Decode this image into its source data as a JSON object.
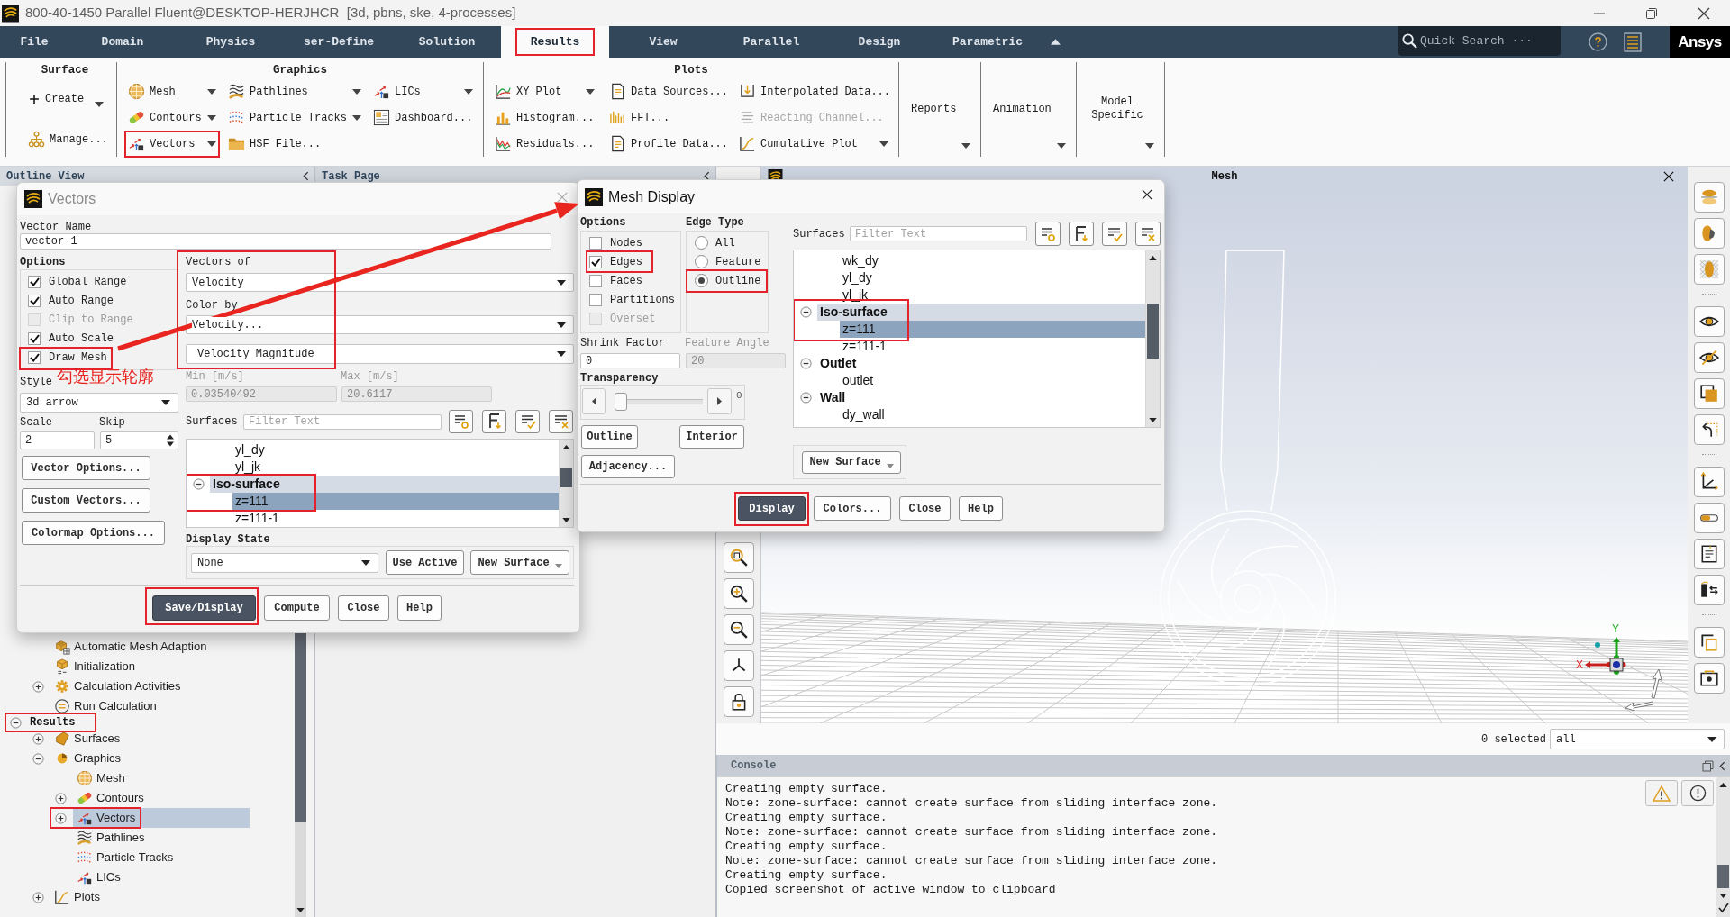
{
  "window": {
    "title": "800-40-1450 Parallel Fluent@DESKTOP-HERJHCR  [3d, pbns, ske, 4-processes]"
  },
  "menu_tabs": [
    {
      "label": "File",
      "selected": false
    },
    {
      "label": "Domain",
      "selected": false
    },
    {
      "label": "Physics",
      "selected": false
    },
    {
      "label": "ser-Define",
      "selected": false
    },
    {
      "label": "Solution",
      "selected": false
    },
    {
      "label": "Results",
      "selected": true,
      "highlighted": true
    },
    {
      "label": "View",
      "selected": false
    },
    {
      "label": "Parallel",
      "selected": false
    },
    {
      "label": "Design",
      "selected": false
    },
    {
      "label": "Parametric",
      "selected": false
    }
  ],
  "quick_search": {
    "placeholder": "Quick Search ···"
  },
  "logo": {
    "text": "Ansys"
  },
  "ribbon": [
    {
      "kind": "stack",
      "title": "Surface",
      "items": [
        {
          "label": "Create",
          "dropdown": true,
          "disabled": false
        },
        {
          "label": "Manage...",
          "disabled": false
        }
      ]
    },
    {
      "kind": "grid",
      "title": "Graphics",
      "columns": [
        [
          {
            "label": "Mesh",
            "dropdown": true,
            "disabled": false
          },
          {
            "label": "Contours",
            "dropdown": true,
            "disabled": false
          },
          {
            "label": "Vectors",
            "dropdown": true,
            "disabled": false,
            "highlighted": true
          }
        ],
        [
          {
            "label": "Pathlines",
            "dropdown": true,
            "disabled": false
          },
          {
            "label": "Particle Tracks",
            "dropdown": true,
            "disabled": false
          },
          {
            "label": "HSF File...",
            "disabled": false
          }
        ],
        [
          {
            "label": "LICs",
            "dropdown": true,
            "disabled": false
          },
          {
            "label": "Dashboard...",
            "disabled": false
          }
        ]
      ]
    },
    {
      "kind": "grid",
      "title": "Plots",
      "columns": [
        [
          {
            "label": "XY Plot",
            "dropdown": true,
            "disabled": false
          },
          {
            "label": "Histogram...",
            "disabled": false
          },
          {
            "label": "Residuals...",
            "disabled": false
          }
        ],
        [
          {
            "label": "Data Sources...",
            "disabled": false
          },
          {
            "label": "FFT...",
            "disabled": false
          },
          {
            "label": "Profile Data...",
            "disabled": false
          }
        ],
        [
          {
            "label": "Interpolated Data...",
            "disabled": false
          },
          {
            "label": "Reacting Channel...",
            "disabled": true
          },
          {
            "label": "Cumulative Plot",
            "dropdown": true,
            "disabled": false
          }
        ]
      ]
    },
    {
      "kind": "menu",
      "label": "Reports"
    },
    {
      "kind": "menu",
      "label": "Animation"
    },
    {
      "kind": "menu",
      "label": "Model Specific"
    }
  ],
  "outline_view": {
    "title": "Outline View",
    "tree": [
      {
        "children": [
          {
            "label": "Automatic Mesh Adaption",
            "selected": false
          },
          {
            "label": "Initialization",
            "selected": false
          },
          {
            "label": "Calculation Activities",
            "expanded": false,
            "selected": false
          },
          {
            "label": "Run Calculation",
            "selected": false
          }
        ]
      },
      {
        "label": "Results",
        "expanded": true,
        "selected": false,
        "highlighted": true,
        "children": [
          {
            "label": "Surfaces",
            "expanded": false,
            "selected": false
          },
          {
            "label": "Graphics",
            "expanded": true,
            "selected": false,
            "children": [
              {
                "label": "Mesh",
                "selected": false
              },
              {
                "label": "Contours",
                "expanded": false,
                "selected": false
              },
              {
                "label": "Vectors",
                "expanded": false,
                "selected": true,
                "highlighted": true
              },
              {
                "label": "Pathlines",
                "selected": false
              },
              {
                "label": "Particle Tracks",
                "selected": false
              },
              {
                "label": "LICs",
                "selected": false
              }
            ]
          },
          {
            "label": "Plots",
            "expanded": false,
            "selected": false
          }
        ]
      }
    ]
  },
  "task_page": {
    "title": "Task Page"
  },
  "graphics_window": {
    "title": "Mesh",
    "triad": {
      "x_label": "X",
      "y_label": "Y"
    },
    "selection": {
      "count": "0 selected",
      "filter": "all"
    }
  },
  "console": {
    "title": "Console",
    "lines": [
      "Creating empty surface.",
      "Note: zone-surface: cannot create surface from sliding interface zone.",
      "Creating empty surface.",
      "Note: zone-surface: cannot create surface from sliding interface zone.",
      "Creating empty surface.",
      "Note: zone-surface: cannot create surface from sliding interface zone.",
      "Creating empty surface.",
      "Copied screenshot of active window to clipboard"
    ]
  },
  "vectors_dialog": {
    "title": "Vectors",
    "active": false,
    "vector_name": {
      "label": "Vector Name",
      "value": "vector-1"
    },
    "options": {
      "label": "Options",
      "items": [
        {
          "label": "Global Range",
          "checked": true,
          "disabled": false
        },
        {
          "label": "Auto Range",
          "checked": true,
          "disabled": false
        },
        {
          "label": "Clip to Range",
          "checked": false,
          "disabled": true
        },
        {
          "label": "Auto Scale",
          "checked": true,
          "disabled": false
        },
        {
          "label": "Draw Mesh",
          "checked": true,
          "disabled": false,
          "highlighted": true
        }
      ]
    },
    "style": {
      "label": "Style",
      "value": "3d arrow"
    },
    "scale": {
      "label": "Scale",
      "value": "2"
    },
    "skip": {
      "label": "Skip",
      "value": "5"
    },
    "side_buttons": [
      {
        "label": "Vector Options..."
      },
      {
        "label": "Custom Vectors..."
      },
      {
        "label": "Colormap Options..."
      }
    ],
    "vectors_of": {
      "label": "Vectors of",
      "value": "Velocity",
      "highlighted": true
    },
    "color_by": {
      "label": "Color by",
      "value": "Velocity...",
      "quantity": "Velocity Magnitude"
    },
    "min": {
      "label": "Min [m/s]",
      "value": "0.03540492",
      "disabled": true
    },
    "max": {
      "label": "Max [m/s]",
      "value": "20.6117",
      "disabled": true
    },
    "surfaces": {
      "label": "Surfaces",
      "placeholder": "Filter Text",
      "items": [
        {
          "children": [
            {
              "label": "yl_dy",
              "selected": false
            },
            {
              "label": "yl_jk",
              "selected": false
            }
          ]
        },
        {
          "label": "Iso-surface",
          "expanded": true,
          "selected": false,
          "highlighted": true,
          "children": [
            {
              "label": "z=111",
              "selected": true
            },
            {
              "label": "z=111-1",
              "selected": false
            }
          ]
        }
      ]
    },
    "display_state": {
      "label": "Display State",
      "value": "None",
      "buttons": [
        {
          "label": "Use Active"
        },
        {
          "label": "New Surface",
          "dropdown": true
        }
      ]
    },
    "buttons": [
      {
        "label": "Save/Display",
        "primary": true,
        "highlighted": true
      },
      {
        "label": "Compute",
        "primary": false
      },
      {
        "label": "Close",
        "primary": false
      },
      {
        "label": "Help",
        "primary": false
      }
    ]
  },
  "mesh_display_dialog": {
    "title": "Mesh Display",
    "active": true,
    "options": {
      "label": "Options",
      "items": [
        {
          "label": "Nodes",
          "checked": false,
          "disabled": false
        },
        {
          "label": "Edges",
          "checked": true,
          "disabled": false,
          "highlighted": true
        },
        {
          "label": "Faces",
          "checked": false,
          "disabled": false
        },
        {
          "label": "Partitions",
          "checked": false,
          "disabled": false
        },
        {
          "label": "Overset",
          "checked": false,
          "disabled": true
        }
      ]
    },
    "edge_type": {
      "label": "Edge Type",
      "items": [
        {
          "label": "All",
          "selected": false
        },
        {
          "label": "Feature",
          "selected": false
        },
        {
          "label": "Outline",
          "selected": true,
          "highlighted": true
        }
      ]
    },
    "shrink_factor": {
      "label": "Shrink Factor",
      "value": "0",
      "disabled": false
    },
    "feature_angle": {
      "label": "Feature Angle",
      "value": "20",
      "disabled": true
    },
    "transparency": {
      "label": "Transparency",
      "level": 0,
      "reading": "0"
    },
    "tool_buttons": [
      {
        "label": "Outline"
      },
      {
        "label": "Interior"
      },
      {
        "label": "Adjacency..."
      }
    ],
    "surfaces": {
      "label": "Surfaces",
      "placeholder": "Filter Text",
      "items": [
        {
          "children": [
            {
              "label": "wk_dy",
              "selected": false
            },
            {
              "label": "yl_dy",
              "selected": false
            },
            {
              "label": "yl_jk",
              "selected": false
            }
          ]
        },
        {
          "label": "Iso-surface",
          "expanded": true,
          "selected": false,
          "highlighted": true,
          "children": [
            {
              "label": "z=111",
              "selected": true
            },
            {
              "label": "z=111-1",
              "selected": false
            }
          ]
        },
        {
          "label": "Outlet",
          "expanded": true,
          "selected": false,
          "children": [
            {
              "label": "outlet",
              "selected": false
            }
          ]
        },
        {
          "label": "Wall",
          "expanded": true,
          "selected": false,
          "children": [
            {
              "label": "dy_wall",
              "selected": false
            }
          ]
        }
      ]
    },
    "new_surface": {
      "label": "New Surface",
      "dropdown": true
    },
    "buttons": [
      {
        "label": "Display",
        "primary": true,
        "highlighted": true
      },
      {
        "label": "Colors...",
        "primary": false
      },
      {
        "label": "Close",
        "primary": false
      },
      {
        "label": "Help",
        "primary": false
      }
    ]
  },
  "annotation": {
    "text": "勾选显示轮廓"
  }
}
